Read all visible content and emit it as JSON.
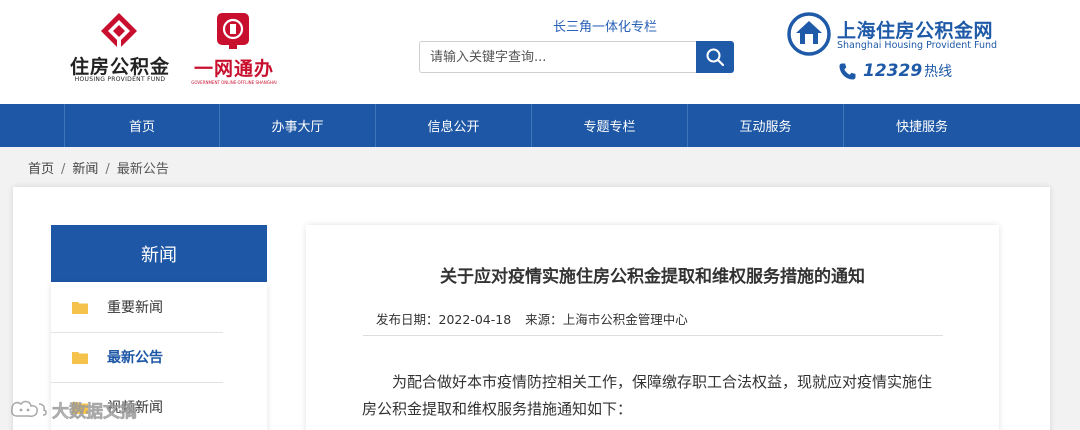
{
  "header": {
    "logo_hpf": {
      "title": "住房公积金",
      "subtitle": "HOUSING PROVIDENT FUND"
    },
    "logo_yiwang": {
      "title": "一网通办",
      "subtitle": "GOVERNMENT ONLINE·OFFLINE SHANGHAI"
    },
    "yrd_link": "长三角一体化专栏",
    "search": {
      "placeholder": "请输入关键字查询..."
    },
    "site_logo": {
      "title": "上海住房公积金网",
      "subtitle": "Shanghai Housing Provident Fund"
    },
    "hotline": {
      "number": "12329",
      "label": "热线"
    }
  },
  "nav": {
    "items": [
      {
        "label": "首页"
      },
      {
        "label": "办事大厅"
      },
      {
        "label": "信息公开"
      },
      {
        "label": "专题专栏"
      },
      {
        "label": "互动服务"
      },
      {
        "label": "快捷服务"
      }
    ]
  },
  "breadcrumb": {
    "items": [
      "首页",
      "新闻",
      "最新公告"
    ]
  },
  "sidebar": {
    "title": "新闻",
    "items": [
      {
        "label": "重要新闻"
      },
      {
        "label": "最新公告"
      },
      {
        "label": "视频新闻"
      }
    ]
  },
  "article": {
    "title": "关于应对疫情实施住房公积金提取和维权服务措施的通知",
    "date_label": "发布日期：",
    "date": "2022-04-18",
    "source_label": "来源：",
    "source": "上海市公积金管理中心",
    "body": "为配合做好本市疫情防控相关工作，保障缴存职工合法权益，现就应对疫情实施住房公积金提取和维权服务措施通知如下："
  },
  "watermark": {
    "text": "大数据文摘"
  },
  "colors": {
    "brand_blue": "#1e57a5",
    "red": "#c8102e",
    "folder": "#f5c34c"
  }
}
